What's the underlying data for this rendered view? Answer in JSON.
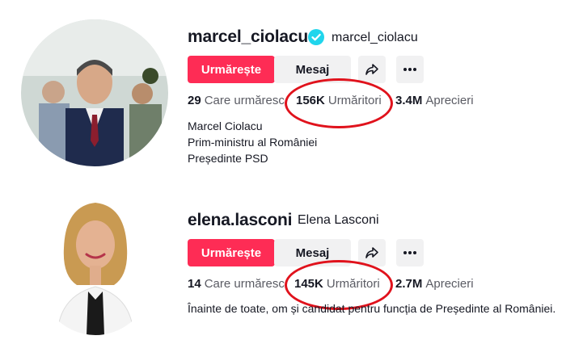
{
  "profiles": [
    {
      "username": "marcel_ciolacu",
      "nickname": "marcel_ciolacu",
      "verified": true,
      "follow_label": "Urmărește",
      "message_label": "Mesaj",
      "share_icon": "share-icon",
      "more_icon": "more-icon",
      "following_count": "29",
      "following_label": "Care urmăresc",
      "followers_count": "156K",
      "followers_label": "Urmăritori",
      "likes_count": "3.4M",
      "likes_label": "Aprecieri",
      "bio": [
        "Marcel Ciolacu",
        "Prim-ministru al României",
        "Președinte PSD"
      ]
    },
    {
      "username": "elena.lasconi",
      "nickname": "Elena Lasconi",
      "verified": false,
      "follow_label": "Urmărește",
      "message_label": "Mesaj",
      "share_icon": "share-icon",
      "more_icon": "more-icon",
      "following_count": "14",
      "following_label": "Care urmăresc",
      "followers_count": "145K",
      "followers_label": "Urmăritori",
      "likes_count": "2.7M",
      "likes_label": "Aprecieri",
      "bio": [
        "Înainte de toate, om și candidat pentru funcția de Președinte al României."
      ]
    }
  ],
  "colors": {
    "accent": "#fe2c55",
    "verified": "#20d5ec",
    "highlight_ring": "#e0121c"
  }
}
